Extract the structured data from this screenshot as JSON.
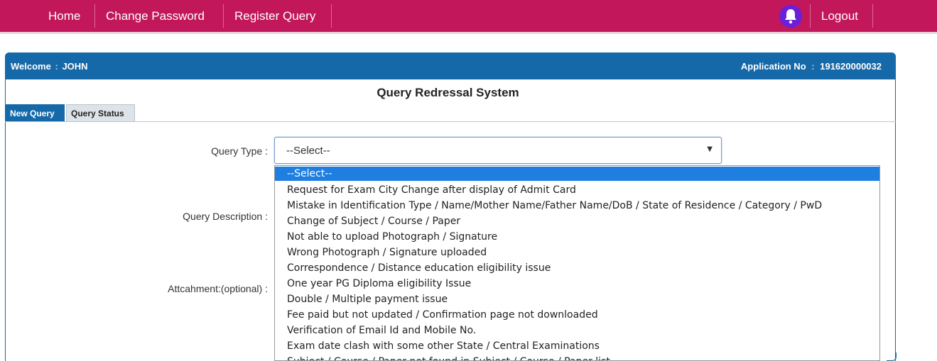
{
  "nav": {
    "home": "Home",
    "change_password": "Change Password",
    "register_query": "Register Query",
    "logout": "Logout"
  },
  "header": {
    "welcome_label": "Welcome",
    "welcome_sep": ":",
    "user_name": "JOHN",
    "app_label": "Application No",
    "app_sep": ":",
    "app_no": "191620000032"
  },
  "page_title": "Query Redressal System",
  "tabs": [
    {
      "label": "New Query",
      "active": true
    },
    {
      "label": "Query Status",
      "active": false
    }
  ],
  "form": {
    "query_type_label": "Query Type :",
    "query_description_label": "Query Description :",
    "attachment_label": "Attcahment:(optional) :",
    "query_type_value": "--Select--"
  },
  "dropdown_options": [
    "--Select--",
    "Request for Exam City Change after display of Admit Card",
    "Mistake in Identification Type / Name/Mother Name/Father Name/DoB / State of Residence / Category / PwD",
    "Change of Subject / Course / Paper",
    "Not able to upload Photograph / Signature",
    "Wrong Photograph / Signature uploaded",
    "Correspondence / Distance education eligibility issue",
    "One year PG Diploma eligibility Issue",
    "Double / Multiple payment issue",
    "Fee paid but not updated / Confirmation page not downloaded",
    "Verification of Email Id and Mobile No.",
    "Exam date clash with some other State / Central Examinations",
    "Subject / Course / Paper not found in Subject / Course / Paper list"
  ],
  "colors": {
    "nav_bg": "#c2185b",
    "panel_blue": "#1669a8",
    "selected_option": "#1e7fe0",
    "bell_bg": "#6a1fd8"
  }
}
